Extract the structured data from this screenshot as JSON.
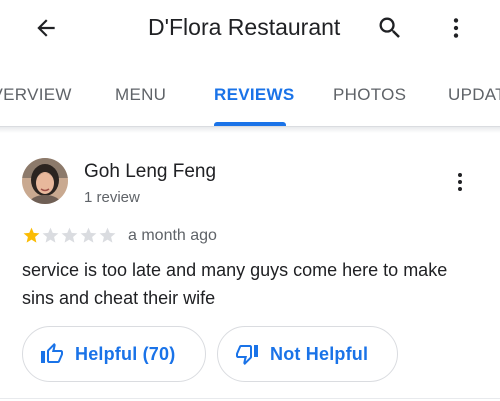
{
  "header": {
    "title": "D'Flora Restaurant",
    "back_icon": "arrow-back-icon",
    "search_icon": "search-icon",
    "more_icon": "more-vert-icon"
  },
  "tabs": [
    {
      "label": "OVERVIEW",
      "active": false
    },
    {
      "label": "MENU",
      "active": false
    },
    {
      "label": "REVIEWS",
      "active": true
    },
    {
      "label": "PHOTOS",
      "active": false
    },
    {
      "label": "UPDATES",
      "active": false
    }
  ],
  "review": {
    "author": "Goh Leng Feng",
    "author_meta": "1 review",
    "rating": 1,
    "rating_max": 5,
    "date": "a month ago",
    "text": "service is too late and many guys come here to make sins and cheat their wife",
    "helpful_label": "Helpful (70)",
    "not_helpful_label": "Not Helpful"
  },
  "colors": {
    "accent": "#1a73e8",
    "star_filled": "#fbbc04",
    "star_empty": "#dadce0",
    "text_primary": "#202124",
    "text_secondary": "#5f6368"
  }
}
